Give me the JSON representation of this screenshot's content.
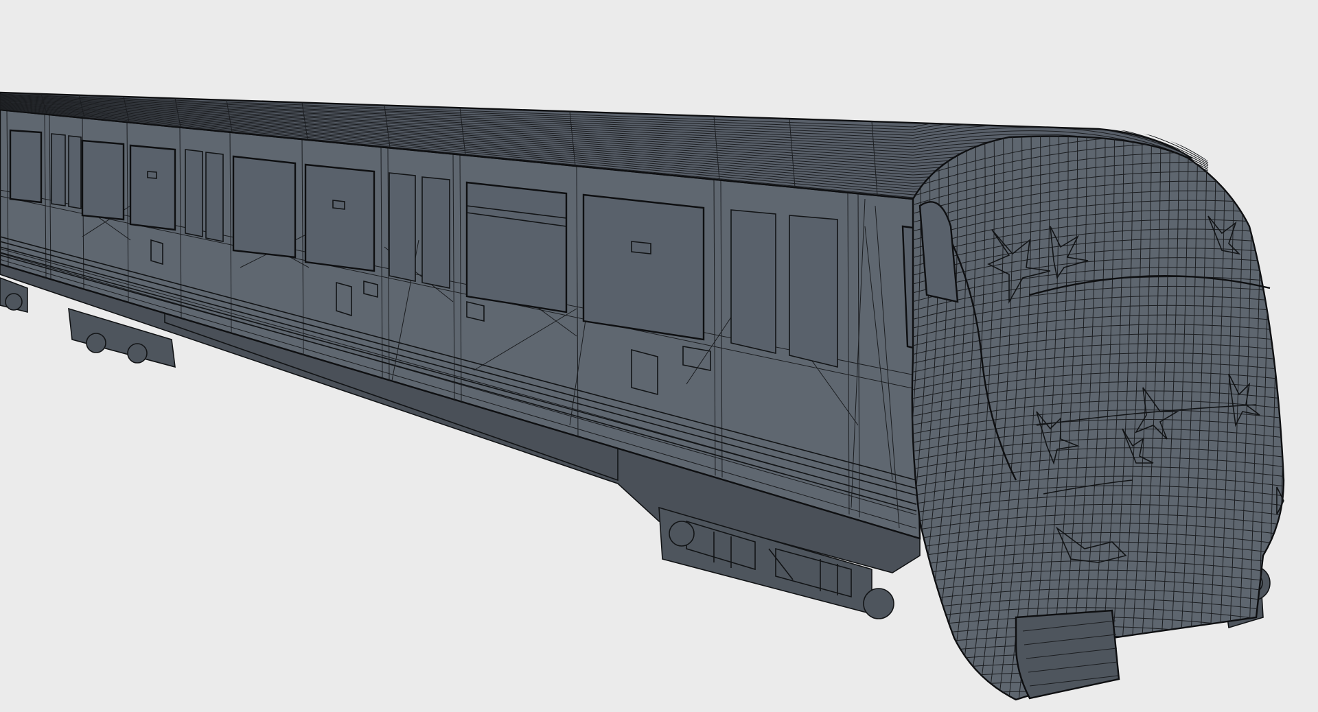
{
  "scene": {
    "subject": "subway-train-wireframe-model",
    "view": "perspective",
    "background_color": "#ebebeb",
    "surface_color": "#5f6770",
    "wire_color": "#141618"
  },
  "train": {
    "doors": 6,
    "windows": 6
  }
}
